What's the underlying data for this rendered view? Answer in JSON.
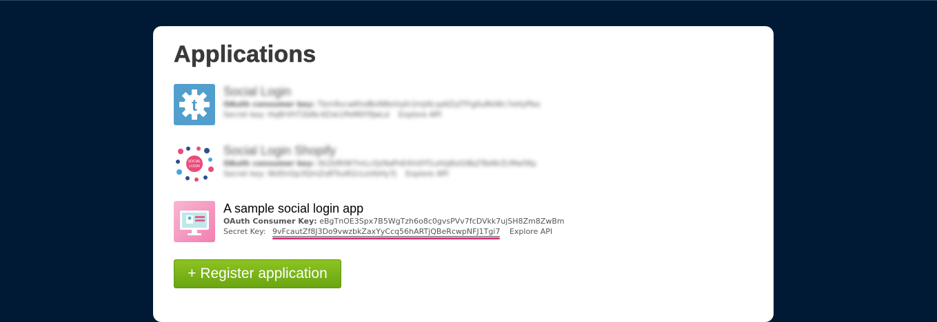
{
  "page": {
    "title": "Applications"
  },
  "apps": [
    {
      "name": "Social Login",
      "consumer_key_label": "OAuth consumer key:",
      "consumer_key": "Tbm9vcwKhdBxN8eVqXr2mJ4Lsp6ZqTfYg0uRkWc7eHyPbo",
      "secret_label": "Secret key:",
      "secret": "Hq8rVhT2bNc4Zxk1PeM0YfJwLd",
      "explore_label": "Explore API",
      "icon": "tumblr-gear-icon"
    },
    {
      "name": "Social Login Shopify",
      "consumer_key_label": "OAuth consumer key:",
      "consumer_key": "Xk2bRtW7mLcQz9aPnE4VdYf1uHsJ6oGiBqT8eNrZcMw5Ky",
      "secret_label": "Secret key:",
      "secret": "Wd5nGp3QmZs8TkxR2cLoVbHy7J",
      "explore_label": "Explore API",
      "icon": "social-login-cluster-icon"
    },
    {
      "name": "A sample social login app",
      "consumer_key_label": "OAuth Consumer Key:",
      "consumer_key": "eBgTnOE3Spx7B5WgTzh6o8c0gvsPVv7fcDVkk7ujSH8Zm8ZwBm",
      "secret_label": "Secret Key:",
      "secret": "9vFcautZf8J3Do9vwzbkZaxYyCcq56hARTjQBeRcwpNFJ1Tgi7",
      "explore_label": "Explore API",
      "icon": "monitor-lock-icon"
    }
  ],
  "register_button": "+ Register application",
  "colors": {
    "background": "#001a35",
    "panel": "#ffffff",
    "accent_green": "#7ab51d",
    "highlight_pink": "#e0357a",
    "tumblr_blue": "#529ecc"
  }
}
